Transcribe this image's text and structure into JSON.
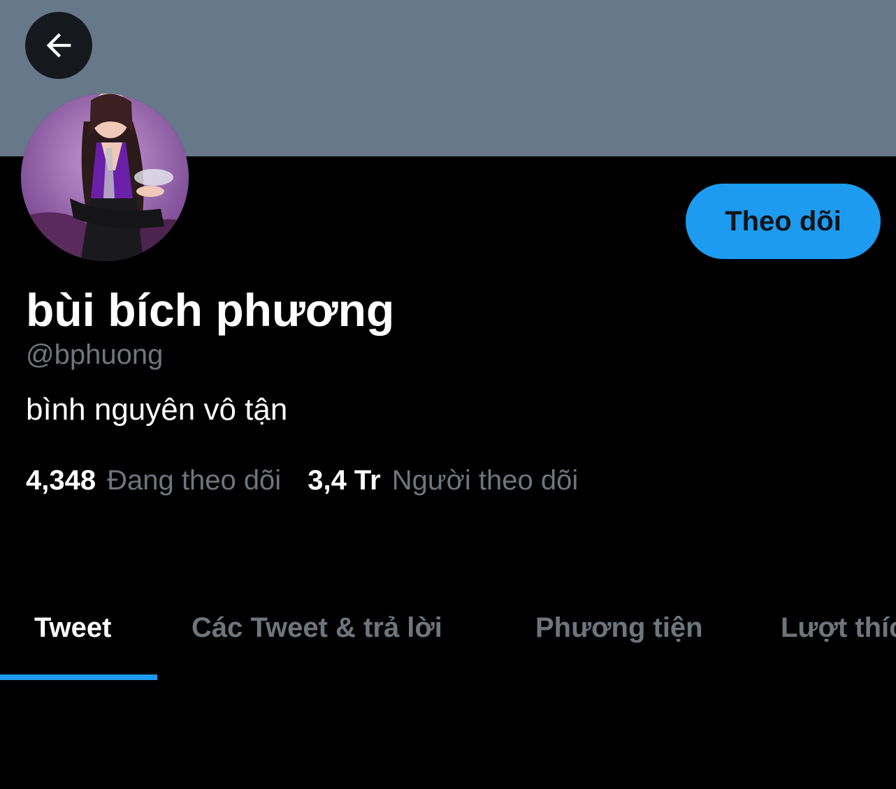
{
  "profile": {
    "display_name": "bùi bích phương",
    "handle": "@bphuong",
    "bio": "bình nguyên vô tận"
  },
  "header": {
    "banner_color": "#66788a",
    "back_icon": "arrow-left-icon"
  },
  "actions": {
    "follow_label": "Theo dõi"
  },
  "stats": {
    "following_count": "4,348",
    "following_label": "Đang theo dõi",
    "followers_count": "3,4 Tr",
    "followers_label": "Người theo dõi"
  },
  "tabs": [
    {
      "label": "Tweet",
      "active": true
    },
    {
      "label": "Các Tweet & trả lời",
      "active": false
    },
    {
      "label": "Phương tiện",
      "active": false
    },
    {
      "label": "Lượt thích",
      "active": false
    }
  ],
  "colors": {
    "accent": "#1d9bf0",
    "secondary_text": "#6e767d",
    "background": "#000000"
  }
}
